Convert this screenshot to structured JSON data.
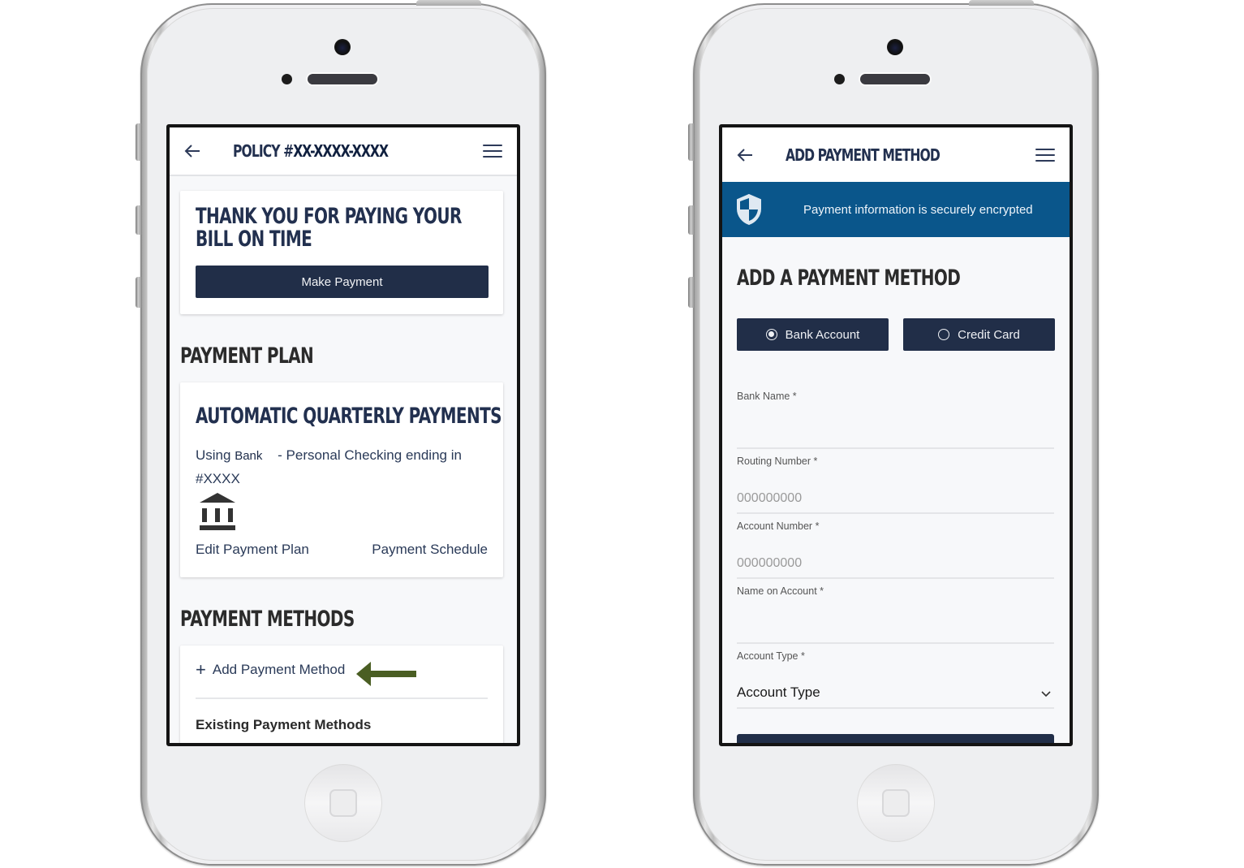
{
  "left_phone": {
    "header": {
      "back_icon": "arrow-left-icon",
      "title_prefix": "POLICY #",
      "title_number": "XX-XXXX-XXXX",
      "menu_icon": "hamburger-menu-icon"
    },
    "thank_card": {
      "heading": "THANK YOU FOR PAYING YOUR BILL ON TIME",
      "button_label": "Make Payment"
    },
    "payment_plan": {
      "section_title": "PAYMENT PLAN",
      "card_heading": "AUTOMATIC QUARTERLY PAYMENTS",
      "using_prefix": "Using",
      "bank_label": "Bank",
      "account_desc": "- Personal Checking ending in",
      "account_number": "#XXXX",
      "bank_icon": "bank-building-icon",
      "edit_link": "Edit Payment Plan",
      "schedule_link": "Payment Schedule"
    },
    "payment_methods": {
      "section_title": "PAYMENT METHODS",
      "add_label": "Add Payment Method",
      "add_icon": "plus-icon",
      "annotation_arrow_color": "#4a5e23",
      "existing_label": "Existing Payment Methods"
    }
  },
  "right_phone": {
    "header": {
      "back_icon": "arrow-left-icon",
      "title": "ADD PAYMENT METHOD",
      "menu_icon": "hamburger-menu-icon"
    },
    "banner": {
      "icon": "shield-icon",
      "message": "Payment information is securely encrypted",
      "color": "#0a568b"
    },
    "form": {
      "title": "ADD A PAYMENT METHOD",
      "type_options": [
        {
          "label": "Bank Account",
          "selected": true
        },
        {
          "label": "Credit Card",
          "selected": false
        }
      ],
      "fields": [
        {
          "label": "Bank Name *",
          "value": "",
          "placeholder": ""
        },
        {
          "label": "Routing Number *",
          "value": "",
          "placeholder": "000000000"
        },
        {
          "label": "Account Number *",
          "value": "",
          "placeholder": "000000000"
        },
        {
          "label": "Name on Account *",
          "value": "",
          "placeholder": ""
        }
      ],
      "account_type": {
        "label": "Account Type *",
        "selected": "Account Type"
      }
    }
  },
  "colors": {
    "primary_navy": "#212e48",
    "heading_navy": "#22304f",
    "screen_bg": "#f7f8fa"
  }
}
